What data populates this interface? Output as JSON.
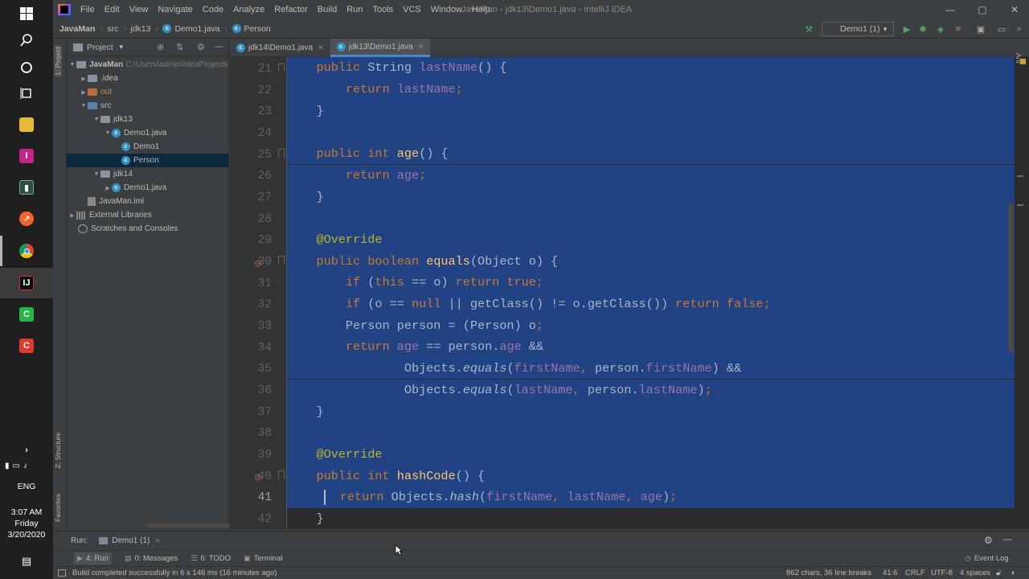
{
  "window": {
    "title": "JavaMan - jdk13\\Demo1.java - IntelliJ IDEA"
  },
  "taskbar": {
    "clock_time": "3:07 AM",
    "clock_day": "Friday",
    "clock_date": "3/20/2020",
    "lang": "ENG"
  },
  "menu": [
    "File",
    "Edit",
    "View",
    "Navigate",
    "Code",
    "Analyze",
    "Refactor",
    "Build",
    "Run",
    "Tools",
    "VCS",
    "Window",
    "Help"
  ],
  "breadcrumb": [
    "JavaMan",
    "src",
    "jdk13",
    "Demo1.java",
    "Person"
  ],
  "toolbar": {
    "run_config": "Demo1 (1)"
  },
  "left_strip": {
    "project": "1: Project",
    "structure": "Z: Structure",
    "favorites": "Favorites"
  },
  "project": {
    "header": "Project",
    "root": "JavaMan",
    "root_path": "C:\\Users\\admin\\IdeaProjects",
    "items": [
      ".idea",
      "out",
      "src",
      "jdk13",
      "Demo1.java",
      "Demo1",
      "Person",
      "jdk14",
      "Demo1.java",
      "JavaMan.iml",
      "External Libraries",
      "Scratches and Consoles"
    ]
  },
  "tabs": [
    {
      "label": "jdk14\\Demo1.java",
      "active": false
    },
    {
      "label": "jdk13\\Demo1.java",
      "active": true
    }
  ],
  "editor": {
    "line_numbers": [
      "21",
      "22",
      "23",
      "24",
      "25",
      "26",
      "27",
      "28",
      "29",
      "30",
      "31",
      "32",
      "33",
      "34",
      "35",
      "36",
      "37",
      "38",
      "39",
      "40",
      "41",
      "42"
    ],
    "current_line": "41"
  },
  "run_bar": {
    "label": "Run:",
    "config": "Demo1 (1)"
  },
  "bottom_tools": [
    "4: Run",
    "0: Messages",
    "6: TODO",
    "Terminal"
  ],
  "event_log": "Event Log",
  "status": {
    "message": "Build completed successfully in 6 s 146 ms (16 minutes ago)",
    "selection": "862 chars, 36 line breaks",
    "position": "41:6",
    "line_sep": "CRLF",
    "encoding": "UTF-8",
    "indent": "4 spaces"
  },
  "colors": {
    "selection": "#214283",
    "keyword": "#cc7832",
    "method": "#ffc66d",
    "field": "#9876aa",
    "annotation": "#bbb529",
    "editor_bg": "#2b2b2b"
  }
}
